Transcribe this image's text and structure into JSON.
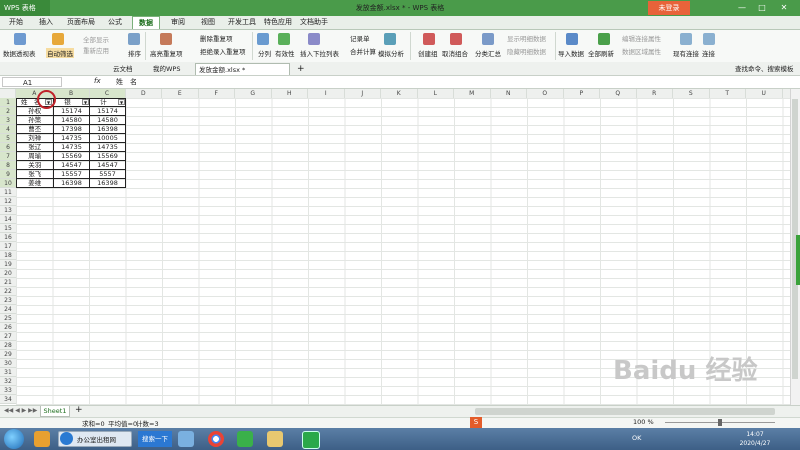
{
  "titlebar": {
    "app_menu": "WPS 表格",
    "doc_title": "发放金额.xlsx * - WPS 表格",
    "login": "未登录",
    "minimize": "—",
    "maximize": "□",
    "close": "✕"
  },
  "menu_tabs": [
    "开始",
    "插入",
    "页面布局",
    "公式",
    "数据",
    "审阅",
    "视图",
    "开发工具",
    "特色应用",
    "文档助手"
  ],
  "menu_active": "数据",
  "ribbon": {
    "pivot": "数据透视表",
    "autofilter": "自动筛选",
    "show_all": "全部显示",
    "reapply": "重新应用",
    "sort": "排序",
    "highlight_dup": "高亮重复项",
    "delete_dup": "删除重复项",
    "reject_dup": "拒绝录入重复项",
    "split": "分列",
    "validity": "有效性",
    "insert_dropdown": "插入下拉列表",
    "record_sheet": "记录单",
    "consolidate": "合并计算",
    "whatif": "模拟分析",
    "create_group": "创建组",
    "ungroup": "取消组合",
    "subtotal": "分类汇总",
    "show_detail": "显示明细数据",
    "hide_detail": "隐藏明细数据",
    "import": "导入数据",
    "refresh_all": "全部刷新",
    "edit_conn": "编辑连接属性",
    "data_area": "数据区域属性",
    "existing_conn": "现有连接",
    "connect": "连接"
  },
  "doc_tabs": {
    "cloud": "云文档",
    "mywps": "我的WPS",
    "file": "发放金额.xlsx *",
    "add": "+",
    "search": "查找命令、搜索模板"
  },
  "formula_bar": {
    "cell_ref": "A1",
    "fx": "fx",
    "content": "姓　名"
  },
  "columns": [
    "A",
    "B",
    "C",
    "D",
    "E",
    "F",
    "G",
    "H",
    "I",
    "J",
    "K",
    "L",
    "M",
    "N",
    "O",
    "P",
    "Q",
    "R",
    "S",
    "T",
    "U"
  ],
  "rows": [
    "1",
    "2",
    "3",
    "4",
    "5",
    "6",
    "7",
    "8",
    "9",
    "10",
    "11",
    "12",
    "13",
    "14",
    "15",
    "16",
    "17",
    "18",
    "19",
    "20",
    "21",
    "22",
    "23",
    "24",
    "25",
    "26",
    "27",
    "28",
    "29",
    "30",
    "31",
    "32",
    "33",
    "34"
  ],
  "table": {
    "headers": [
      "姓　名",
      "银",
      "计"
    ],
    "data": [
      [
        "孙权",
        "15174",
        "15174"
      ],
      [
        "孙策",
        "14580",
        "14580"
      ],
      [
        "曹丕",
        "17398",
        "16398"
      ],
      [
        "刘禅",
        "14735",
        "10005"
      ],
      [
        "张辽",
        "14735",
        "14735"
      ],
      [
        "周瑜",
        "15569",
        "15569"
      ],
      [
        "关羽",
        "14547",
        "14547"
      ],
      [
        "张飞",
        "15557",
        "5557"
      ],
      [
        "姜维",
        "16398",
        "16398"
      ]
    ]
  },
  "sheet_tab": "Sheet1",
  "sheet_add": "+",
  "status": {
    "sum": "求和=0",
    "avg": "平均值=0",
    "count": "计数=3",
    "zoom": "100 %"
  },
  "taskbar": {
    "ie_tab": "办公室出租网",
    "search_btn": "搜索一下",
    "time": "14:07",
    "date": "2020/4/27",
    "ok": "OK"
  },
  "watermark": "Baidu 经验",
  "colors": {
    "accent": "#4a9b4a",
    "login": "#e8633a",
    "circle": "#c0222a"
  }
}
